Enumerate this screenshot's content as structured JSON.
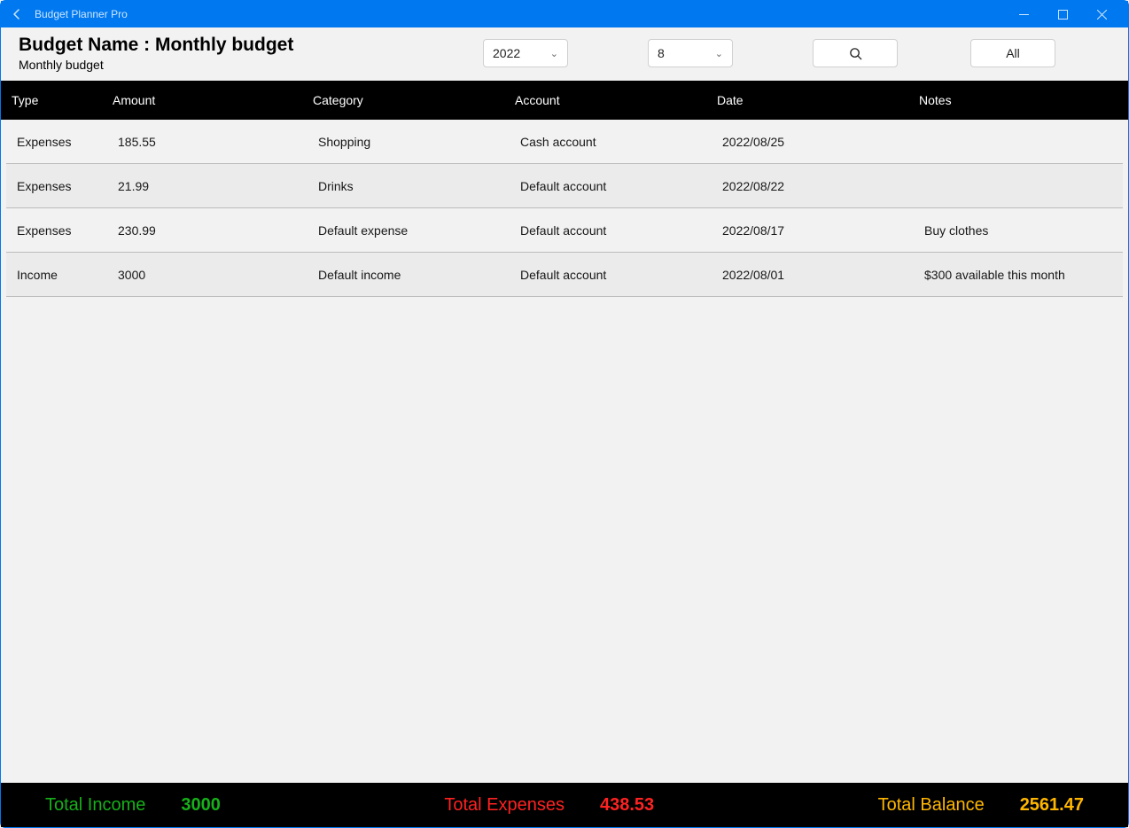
{
  "window": {
    "title": "Budget Planner Pro"
  },
  "header": {
    "title": "Budget Name : Monthly budget",
    "subtitle": "Monthly budget",
    "year": "2022",
    "month": "8",
    "all_label": "All"
  },
  "columns": {
    "type": "Type",
    "amount": "Amount",
    "category": "Category",
    "account": "Account",
    "date": "Date",
    "notes": "Notes"
  },
  "rows": [
    {
      "type": "Expenses",
      "amount": "185.55",
      "category": "Shopping",
      "account": "Cash account",
      "date": "2022/08/25",
      "notes": ""
    },
    {
      "type": "Expenses",
      "amount": "21.99",
      "category": "Drinks",
      "account": "Default account",
      "date": "2022/08/22",
      "notes": ""
    },
    {
      "type": "Expenses",
      "amount": "230.99",
      "category": "Default expense",
      "account": "Default account",
      "date": "2022/08/17",
      "notes": "Buy clothes"
    },
    {
      "type": "Income",
      "amount": "3000",
      "category": "Default income",
      "account": "Default account",
      "date": "2022/08/01",
      "notes": "$300 available this month"
    }
  ],
  "footer": {
    "income_label": "Total Income",
    "income_value": "3000",
    "expenses_label": "Total Expenses",
    "expenses_value": "438.53",
    "balance_label": "Total Balance",
    "balance_value": "2561.47"
  }
}
